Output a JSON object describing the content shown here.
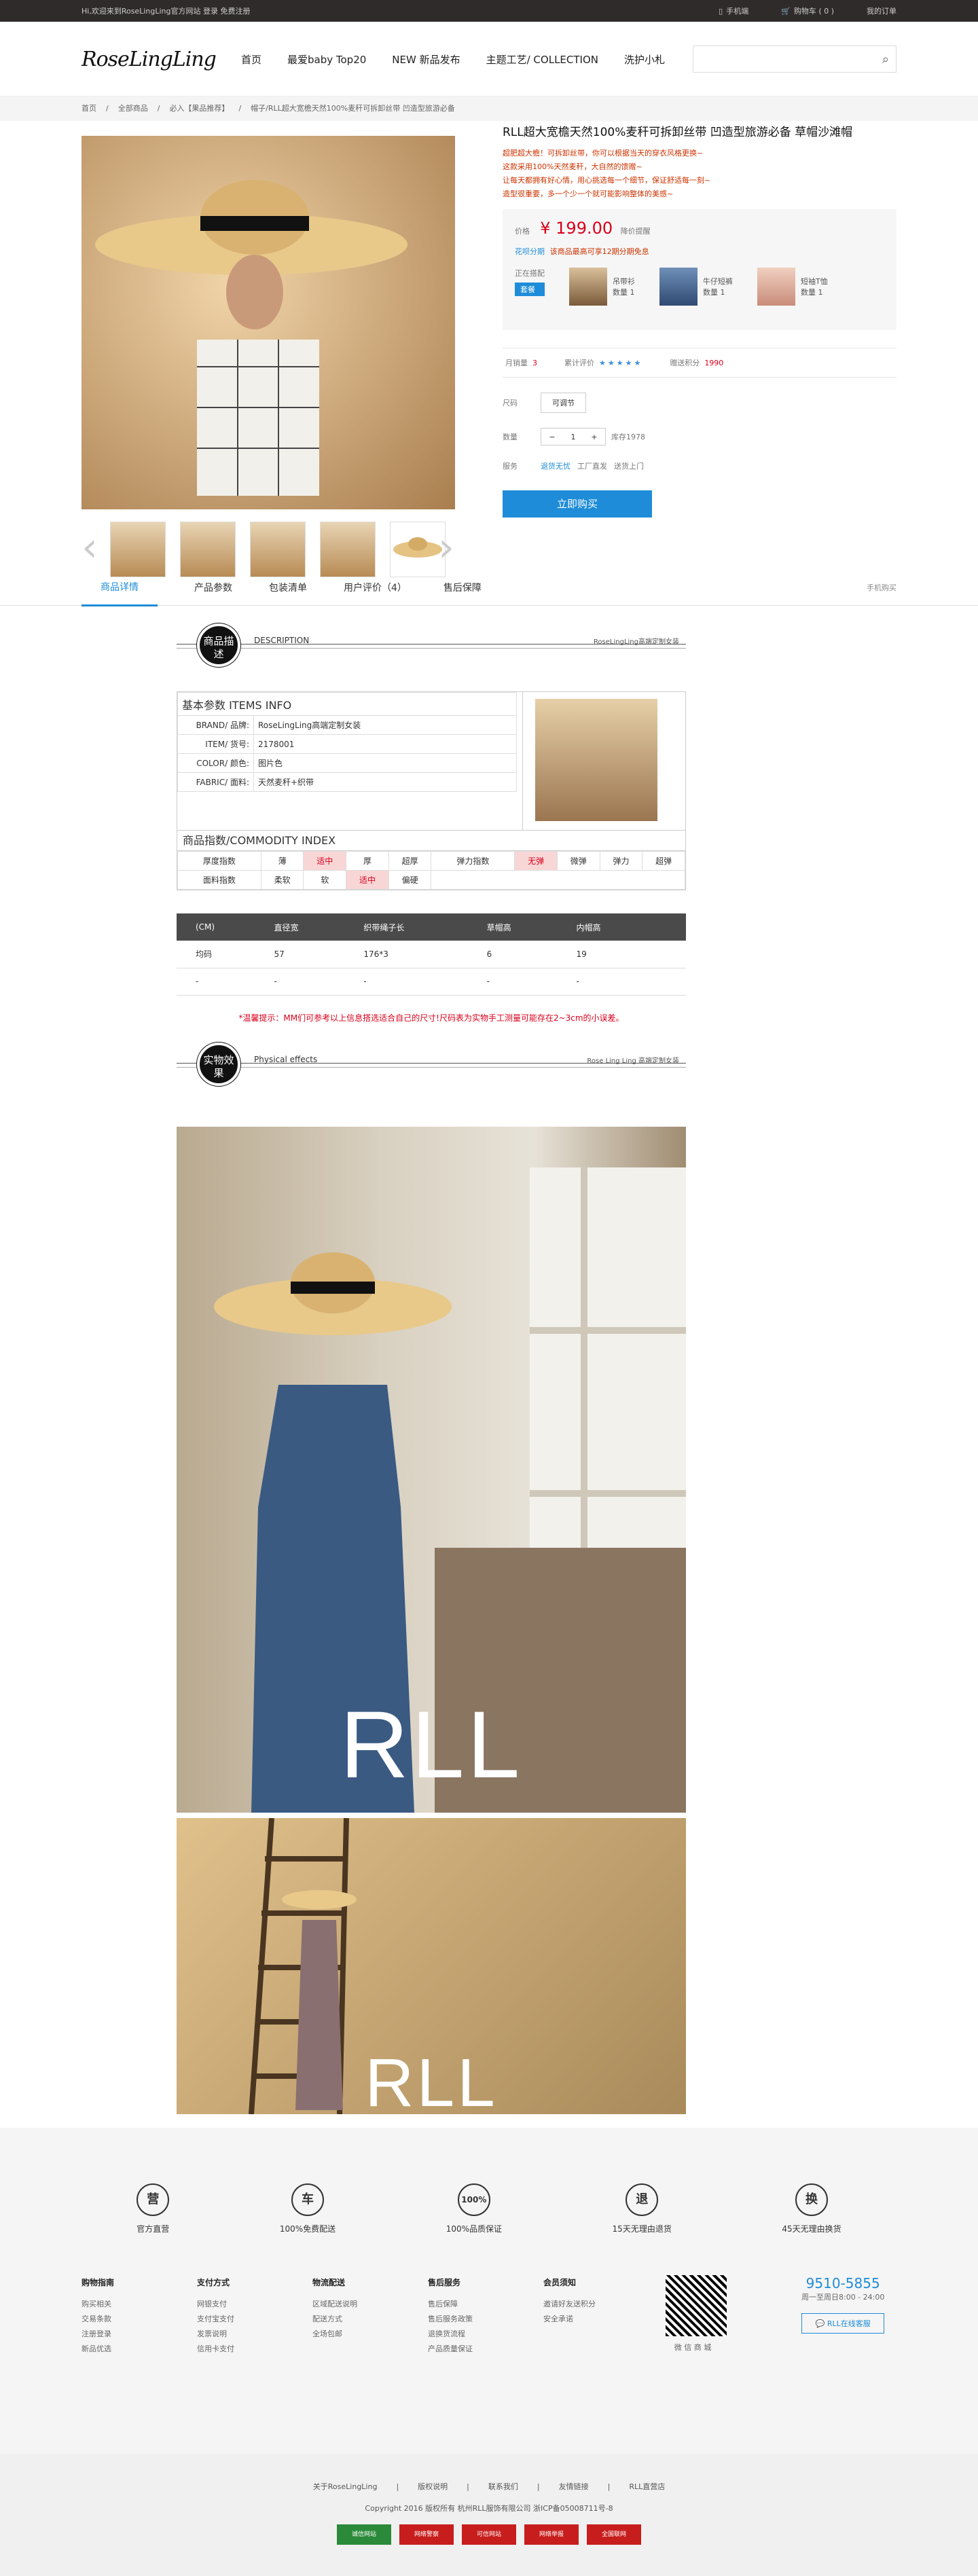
{
  "topbar": {
    "welcome": "Hi,欢迎来到RoseLingLing官方网站    登录    免费注册",
    "mobile": "手机端",
    "cart": "购物车 ( 0 )",
    "orders": "我的订单"
  },
  "header": {
    "logo": "RoseLingLing",
    "nav": [
      "首页",
      "最爱baby Top20",
      "NEW 新品发布",
      "主题工艺/ COLLECTION",
      "洗护小札"
    ]
  },
  "crumb": [
    "首页",
    "/",
    "全部商品",
    "/",
    "必入【果品推荐】",
    "/",
    "帽子/RLL超大宽檐天然100%麦秆可拆卸丝带 凹造型旅游必备"
  ],
  "product": {
    "title": "RLL超大宽檐天然100%麦秆可拆卸丝带 凹造型旅游必备 草帽沙滩帽",
    "promos": [
      "超肥超大檐！可拆卸丝带，你可以根据当天的穿衣风格更换~",
      "这款采用100%天然麦秆，大自然的馈赠~",
      "让每天都拥有好心情，用心挑选每一个细节，保证舒适每一刻~",
      "造型很重要，多一个少一个就可能影响整体的美感~"
    ],
    "price_label": "价格",
    "price": "¥ 199.00",
    "price_note": "降价提醒",
    "coupon_label": "花呗分期",
    "coupon": "该商品最高可享12期分期免息",
    "combo_label": "正在搭配",
    "combo_tag": "套餐",
    "combo": [
      {
        "name": "吊带衫",
        "count": "数量 1"
      },
      {
        "name": "牛仔短裤",
        "count": "数量 1"
      },
      {
        "name": "短袖T恤",
        "count": "数量 1"
      }
    ],
    "sales_label": "月销量",
    "sales": "3",
    "rating_label": "累计评价",
    "stars": "★★★★★",
    "points_label": "赠送积分",
    "points": "1990",
    "size_label": "尺码",
    "size_value": "可调节",
    "qty_label": "数量",
    "qty": "1",
    "stock": "库存1978",
    "service_label": "服务",
    "services": [
      "退货无忧",
      "工厂直发",
      "送货上门"
    ],
    "buy": "立即购买"
  },
  "tabs": [
    "商品详情",
    "产品参数",
    "包装清单",
    "用户评价（4）",
    "售后保障"
  ],
  "tabs_right": "手机购买",
  "desc": {
    "badge": "商品描述",
    "en": "DESCRIPTION",
    "brand": "RoseLingLing高端定制女装",
    "basic_title": "基本参数  ITEMS INFO",
    "rows": [
      [
        "BRAND/ 品牌:",
        "RoseLingLing高端定制女装"
      ],
      [
        "ITEM/ 货号:",
        "2178001"
      ],
      [
        "COLOR/ 颜色:",
        "图片色"
      ],
      [
        "FABRIC/ 面料:",
        "天然麦秆+织带"
      ]
    ],
    "index_title": "商品指数/COMMODITY INDEX",
    "idx1": [
      "厚度指数",
      "薄",
      "适中",
      "厚",
      "超厚",
      "弹力指数",
      "无弹",
      "微弹",
      "弹力",
      "超弹"
    ],
    "idx2": [
      "面料指数",
      "柔软",
      "软",
      "适中",
      "偏硬"
    ]
  },
  "sizes": {
    "head": [
      "(CM)",
      "直径宽",
      "织带绳子长",
      "草帽高",
      "内帽高"
    ],
    "rows": [
      [
        "均码",
        "57",
        "176*3",
        "6",
        "19"
      ],
      [
        "-",
        "-",
        "-",
        "-",
        "-"
      ]
    ]
  },
  "tip": "*温馨提示：MM们可参考以上信息搭选适合自己的尺寸!尺码表为实物手工测量可能存在2~3cm的小误差。",
  "effects": {
    "badge": "实物效果",
    "en": "Physical effects",
    "brand": "Rose Ling Ling 高端定制女装",
    "wm": "RLL"
  },
  "services": [
    {
      "icon": "营",
      "label": "官方直营"
    },
    {
      "icon": "车",
      "label": "100%免费配送"
    },
    {
      "icon": "100%",
      "label": "100%品质保证"
    },
    {
      "icon": "退",
      "label": "15天无理由退货"
    },
    {
      "icon": "换",
      "label": "45天无理由换货"
    }
  ],
  "footer_links": [
    {
      "title": "购物指南",
      "items": [
        "购买相关",
        "交易条款",
        "注册登录",
        "新品优选"
      ]
    },
    {
      "title": "支付方式",
      "items": [
        "网银支付",
        "支付宝支付",
        "发票说明",
        "信用卡支付"
      ]
    },
    {
      "title": "物流配送",
      "items": [
        "区域配送说明",
        "配送方式",
        "全场包邮"
      ]
    },
    {
      "title": "售后服务",
      "items": [
        "售后保障",
        "售后服务政策",
        "退换货流程",
        "产品质量保证"
      ]
    },
    {
      "title": "会员须知",
      "items": [
        "邀请好友送积分",
        "安全承诺"
      ]
    }
  ],
  "qr_label": "微 信 商 城",
  "hotline": {
    "num": "9510-5855",
    "hours": "周一至周日8:00 - 24:00",
    "btn": "RLL在线客服"
  },
  "footer": {
    "links": [
      "关于RoseLingLing",
      "|",
      "版权说明",
      "|",
      "联系我们",
      "|",
      "友情链接",
      "|",
      "RLL直营店"
    ],
    "copyright": "Copyright 2016 版权所有 杭州RLL服饰有限公司 浙ICP备05008711号-8",
    "certs": [
      "诚信网站",
      "网络警察",
      "可信网站",
      "网络举报",
      "全国联网"
    ]
  }
}
